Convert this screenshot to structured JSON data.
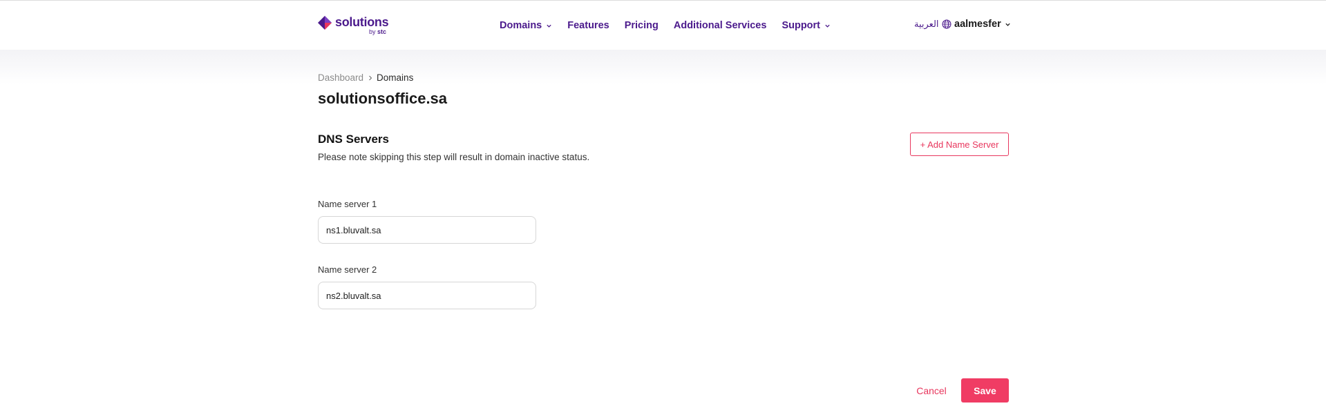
{
  "brand": {
    "name": "solutions",
    "by_prefix": "by",
    "by_brand": "stc",
    "color": "#4b1a8c",
    "accent": "#e8365d"
  },
  "nav": {
    "items": [
      {
        "label": "Domains",
        "has_dropdown": true
      },
      {
        "label": "Features",
        "has_dropdown": false
      },
      {
        "label": "Pricing",
        "has_dropdown": false
      },
      {
        "label": "Additional Services",
        "has_dropdown": false
      },
      {
        "label": "Support",
        "has_dropdown": true
      }
    ]
  },
  "header": {
    "language_label": "العربية",
    "language_icon": "globe-icon",
    "username": "aalmesfer"
  },
  "breadcrumb": {
    "items": [
      "Dashboard",
      "Domains"
    ]
  },
  "page": {
    "title": "solutionsoffice.sa"
  },
  "dns": {
    "section_title": "DNS Servers",
    "note": "Please note skipping this step will result in domain inactive status.",
    "add_button_label": "+ Add Name Server",
    "name_servers": [
      {
        "label": "Name server 1",
        "value": "ns1.bluvalt.sa"
      },
      {
        "label": "Name server 2",
        "value": "ns2.bluvalt.sa"
      }
    ]
  },
  "actions": {
    "cancel_label": "Cancel",
    "save_label": "Save"
  }
}
